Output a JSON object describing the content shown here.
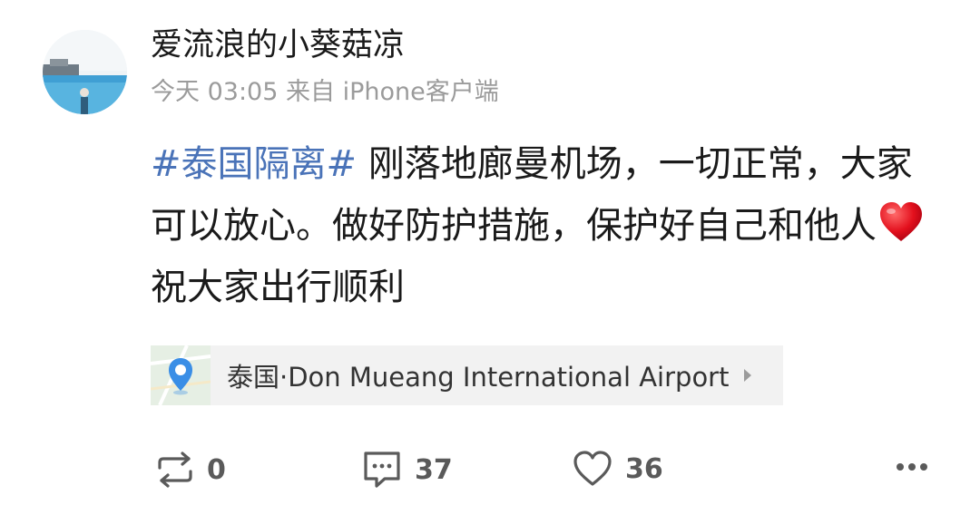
{
  "author": {
    "name": "爱流浪的小葵菇凉",
    "avatar_icon": "avatar-sea-photo"
  },
  "meta": {
    "time": "今天 03:05",
    "source": "来自 iPhone客户端"
  },
  "post": {
    "hashtag": "#泰国隔离#",
    "text_part1": " 刚落地廊曼机场，一切正常，大家可以放心。做好防护措施，保护好自己和他人",
    "emoji_icon": "red-heart-icon",
    "text_part2": "祝大家出行顺利"
  },
  "location": {
    "label": "泰国·Don Mueang International Airport",
    "icon": "map-pin-icon",
    "accent_color": "#3a8ee6"
  },
  "actions": {
    "repost_count": "0",
    "comment_count": "37",
    "like_count": "36"
  },
  "colors": {
    "hashtag": "#4a73b8",
    "meta": "#9b9b9b",
    "icon": "#5a5a5a"
  }
}
